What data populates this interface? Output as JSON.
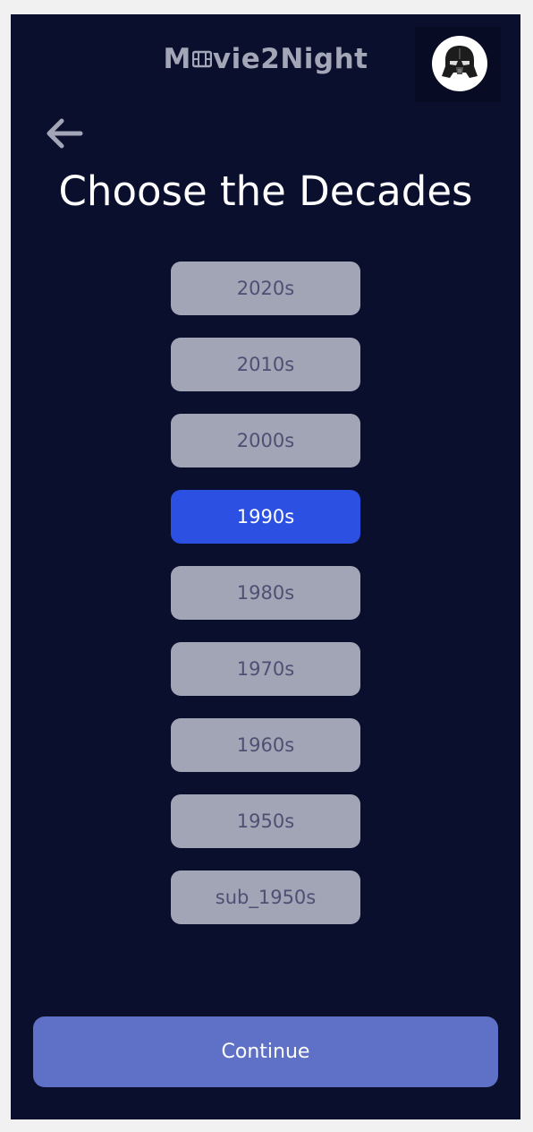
{
  "app": {
    "logo_before": "M",
    "logo_after": "vie2Night",
    "logo_icon": "film-reel-icon",
    "avatar_icon": "darth-vader-helmet-icon"
  },
  "nav": {
    "back_icon": "arrow-left-icon"
  },
  "page": {
    "title": "Choose the Decades"
  },
  "decades": [
    {
      "label": "2020s",
      "selected": false
    },
    {
      "label": "2010s",
      "selected": false
    },
    {
      "label": "2000s",
      "selected": false
    },
    {
      "label": "1990s",
      "selected": true
    },
    {
      "label": "1980s",
      "selected": false
    },
    {
      "label": "1970s",
      "selected": false
    },
    {
      "label": "1960s",
      "selected": false
    },
    {
      "label": "1950s",
      "selected": false
    },
    {
      "label": "sub_1950s",
      "selected": false
    }
  ],
  "actions": {
    "continue_label": "Continue"
  },
  "colors": {
    "background": "#0a0f2d",
    "option_default": "#a2a5b6",
    "option_default_text": "#4c5173",
    "option_selected": "#2b50e2",
    "continue_button": "#5e71c7"
  }
}
